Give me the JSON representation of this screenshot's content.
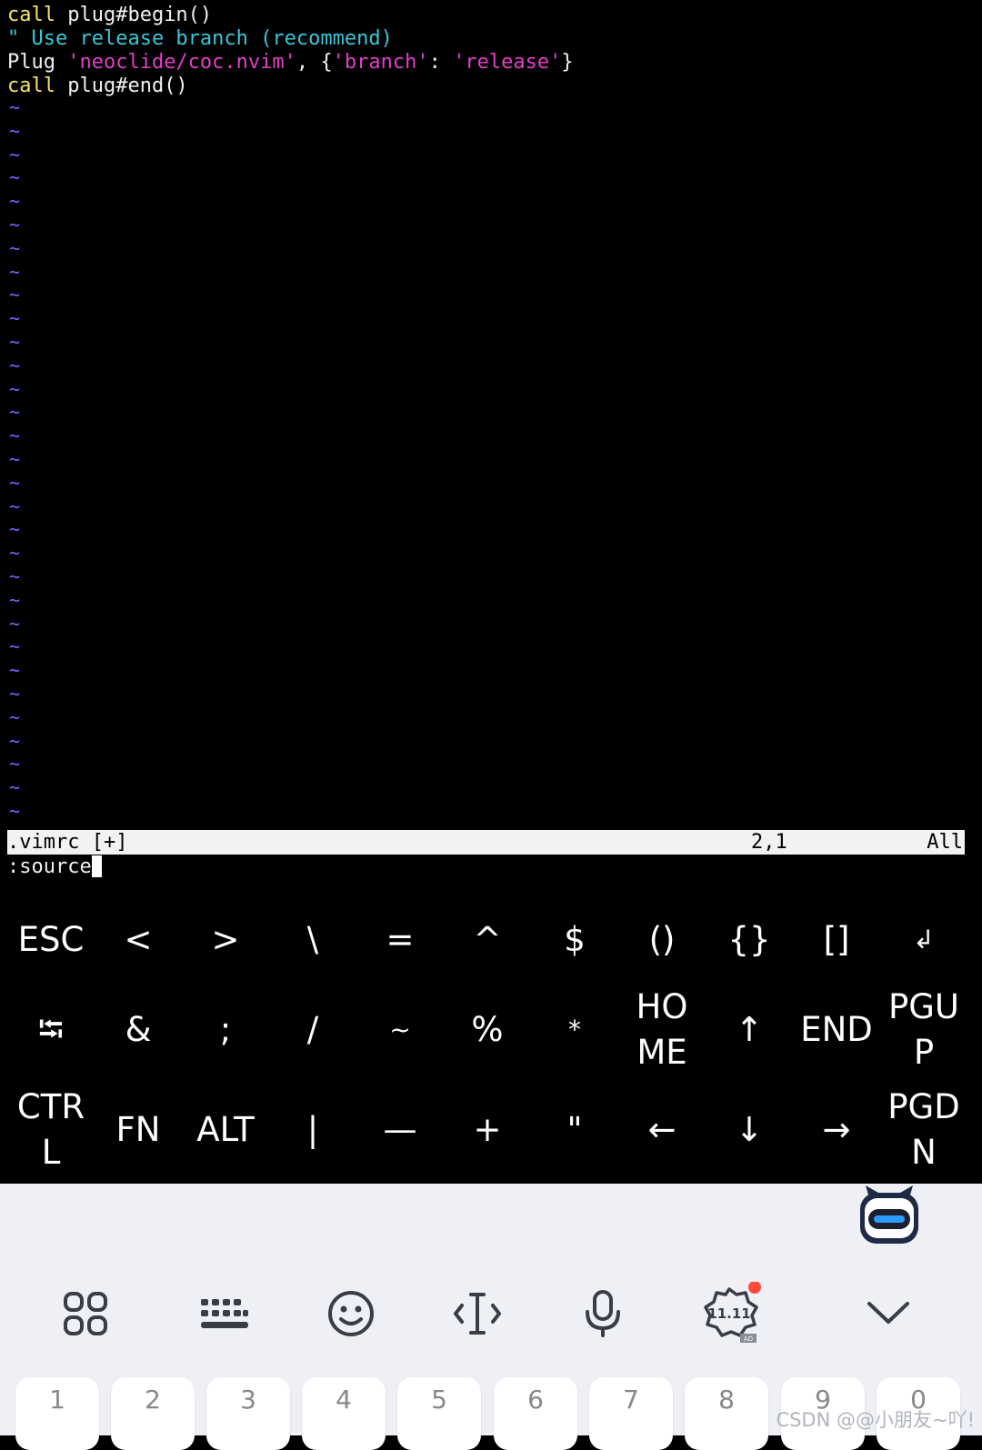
{
  "editor": {
    "line1": {
      "kw": "call",
      "rest": " plug#begin()"
    },
    "line2": {
      "comment": "\" Use release branch (recommend)"
    },
    "line3": {
      "plug": "Plug ",
      "repo": "'neoclide/coc.nvim'",
      "sep": ", {",
      "key": "'branch'",
      "colon": ": ",
      "val": "'release'",
      "end": "}"
    },
    "line4": {
      "kw": "call",
      "rest": " plug#end()"
    },
    "tilde": "~"
  },
  "statusbar": {
    "filename": ".vimrc [+]",
    "position": "2,1",
    "scroll": "All"
  },
  "cmdline": {
    "text": ":source"
  },
  "extra_keys": {
    "row1": [
      "ESC",
      "<",
      ">",
      "\\",
      "=",
      "^",
      "$",
      "()",
      "{}",
      "[]",
      "↲"
    ],
    "row2": [
      "⭾",
      "&",
      ";",
      "/",
      "~",
      "%",
      "*",
      "HO\nME",
      "↑",
      "END",
      "PGU\nP"
    ],
    "row3": [
      "CTR\nL",
      "FN",
      "ALT",
      "|",
      "—",
      "+",
      "\"",
      "←",
      "↓",
      "→",
      "PGD\nN"
    ]
  },
  "ime_toolbar": {
    "icons": [
      "apps-grid-icon",
      "keyboard-icon",
      "emoji-icon",
      "cursor-text-icon",
      "microphone-icon",
      "promo-badge-icon",
      "collapse-chevron-icon"
    ],
    "promo_text": "11.11",
    "promo_ad": "AD"
  },
  "number_row": [
    "1",
    "2",
    "3",
    "4",
    "5",
    "6",
    "7",
    "8",
    "9",
    "0"
  ],
  "watermark": "CSDN @@小朋友~吖!"
}
